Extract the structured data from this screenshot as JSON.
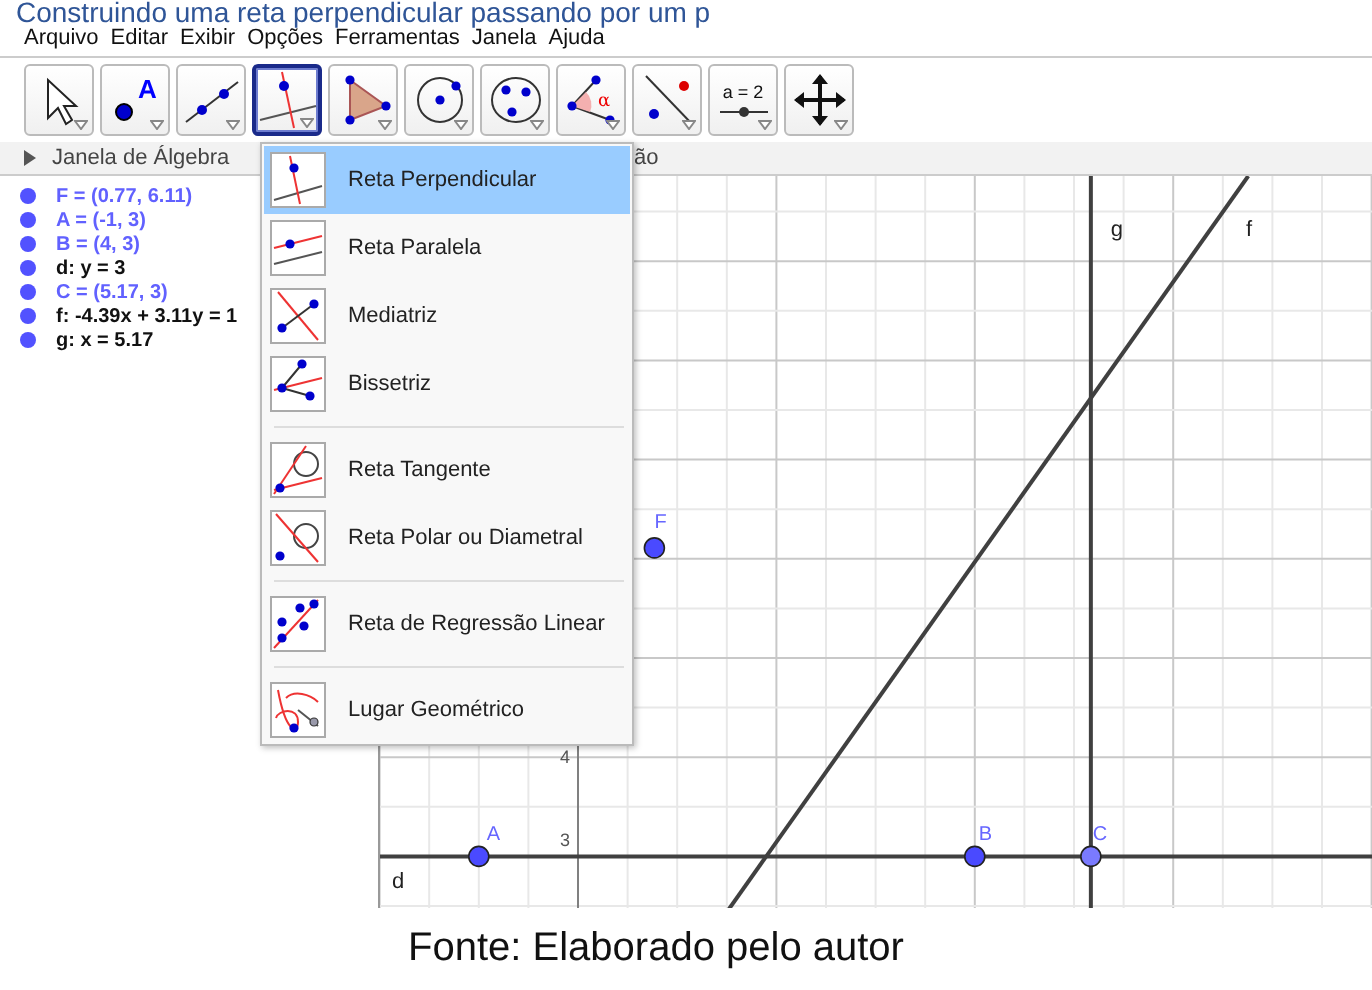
{
  "heading": "Construindo uma reta perpendicular passando por um p",
  "menu": [
    "Arquivo",
    "Editar",
    "Exibir",
    "Opções",
    "Ferramentas",
    "Janela",
    "Ajuda"
  ],
  "toolbar": [
    {
      "kind": "move",
      "selected": false
    },
    {
      "kind": "point",
      "selected": false,
      "glyph": "A"
    },
    {
      "kind": "line",
      "selected": false
    },
    {
      "kind": "perpendicular",
      "selected": true
    },
    {
      "kind": "polygon",
      "selected": false
    },
    {
      "kind": "circle",
      "selected": false
    },
    {
      "kind": "ellipse",
      "selected": false
    },
    {
      "kind": "angle",
      "selected": false,
      "glyph": "α"
    },
    {
      "kind": "reflect",
      "selected": false
    },
    {
      "kind": "slider",
      "selected": false
    },
    {
      "kind": "pan",
      "selected": false
    }
  ],
  "slider_label": "a = 2",
  "algebra_view": {
    "title": "Janela de Álgebra",
    "items": [
      {
        "text": "F = (0.77, 6.11)",
        "free": true
      },
      {
        "text": "A = (-1, 3)",
        "free": true
      },
      {
        "text": "B = (4, 3)",
        "free": true
      },
      {
        "text": "d: y = 3",
        "free": false
      },
      {
        "text": "C = (5.17, 3)",
        "free": true
      },
      {
        "text": "f: -4.39x + 3.11y = 1",
        "free": false
      },
      {
        "text": "g: x = 5.17",
        "free": false
      }
    ]
  },
  "graphics_view": {
    "title": "ão",
    "axis_labels": [
      "4",
      "3"
    ],
    "points": [
      "A",
      "B",
      "C",
      "F"
    ],
    "lines": [
      "d",
      "f",
      "g"
    ]
  },
  "dropdown": [
    [
      {
        "label": "Reta Perpendicular",
        "kind": "perpendicular",
        "selected": true
      },
      {
        "label": "Reta Paralela",
        "kind": "parallel",
        "selected": false
      },
      {
        "label": "Mediatriz",
        "kind": "bisector",
        "selected": false
      },
      {
        "label": "Bissetriz",
        "kind": "angle-bisector",
        "selected": false
      }
    ],
    [
      {
        "label": "Reta Tangente",
        "kind": "tangent",
        "selected": false
      },
      {
        "label": "Reta Polar ou Diametral",
        "kind": "polar",
        "selected": false
      }
    ],
    [
      {
        "label": "Reta de Regressão Linear",
        "kind": "regression",
        "selected": false
      }
    ],
    [
      {
        "label": "Lugar Geométrico",
        "kind": "locus",
        "selected": false
      }
    ]
  ],
  "caption": "Fonte: Elaborado pelo autor"
}
